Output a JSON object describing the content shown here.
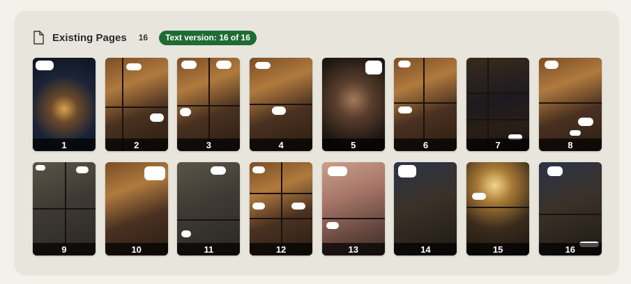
{
  "header": {
    "title": "Existing Pages",
    "count": "16",
    "badge": "Text version: 16 of 16",
    "icon": "file-icon"
  },
  "colors": {
    "background": "#f3f1ea",
    "panel": "#e8e5dd",
    "badge": "#1f6b34"
  },
  "pages": [
    {
      "number": "1",
      "theme": "night-house"
    },
    {
      "number": "2",
      "theme": "warm-interior"
    },
    {
      "number": "3",
      "theme": "warm-interior"
    },
    {
      "number": "4",
      "theme": "warm-interior"
    },
    {
      "number": "5",
      "theme": "dark-closeup"
    },
    {
      "number": "6",
      "theme": "warm-interior"
    },
    {
      "number": "7",
      "theme": "dark-hallway"
    },
    {
      "number": "8",
      "theme": "warm-interior"
    },
    {
      "number": "9",
      "theme": "dim-room"
    },
    {
      "number": "10",
      "theme": "warm-interior"
    },
    {
      "number": "11",
      "theme": "dim-room"
    },
    {
      "number": "12",
      "theme": "warm-interior"
    },
    {
      "number": "13",
      "theme": "pink-bedroom"
    },
    {
      "number": "14",
      "theme": "night-room"
    },
    {
      "number": "15",
      "theme": "phone-glow"
    },
    {
      "number": "16",
      "theme": "night-room"
    }
  ]
}
